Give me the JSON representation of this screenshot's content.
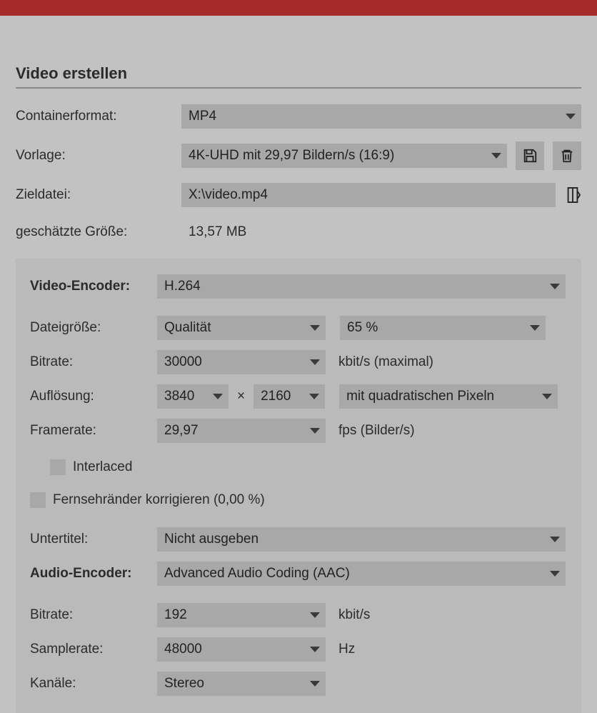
{
  "title": "Video erstellen",
  "outer": {
    "container_label": "Containerformat:",
    "container_value": "MP4",
    "template_label": "Vorlage:",
    "template_value": "4K-UHD mit 29,97 Bildern/s (16:9)",
    "target_label": "Zieldatei:",
    "target_value": "X:\\video.mp4",
    "size_label": "geschätzte Größe:",
    "size_value": "13,57 MB"
  },
  "video": {
    "encoder_label": "Video-Encoder:",
    "encoder_value": "H.264",
    "filesize_label": "Dateigröße:",
    "filesize_mode": "Qualität",
    "filesize_quality": "65 %",
    "bitrate_label": "Bitrate:",
    "bitrate_value": "30000",
    "bitrate_unit": "kbit/s (maximal)",
    "resolution_label": "Auflösung:",
    "resolution_w": "3840",
    "resolution_h": "2160",
    "resolution_mult": "×",
    "pixel_aspect": "mit quadratischen Pixeln",
    "framerate_label": "Framerate:",
    "framerate_value": "29,97",
    "framerate_unit": "fps (Bilder/s)",
    "interlaced_label": "Interlaced",
    "tvborders_label": "Fernsehränder korrigieren (0,00 %)",
    "subtitle_label": "Untertitel:",
    "subtitle_value": "Nicht ausgeben"
  },
  "audio": {
    "encoder_label": "Audio-Encoder:",
    "encoder_value": "Advanced Audio Coding (AAC)",
    "bitrate_label": "Bitrate:",
    "bitrate_value": "192",
    "bitrate_unit": "kbit/s",
    "samplerate_label": "Samplerate:",
    "samplerate_value": "48000",
    "samplerate_unit": "Hz",
    "channels_label": "Kanäle:",
    "channels_value": "Stereo"
  }
}
